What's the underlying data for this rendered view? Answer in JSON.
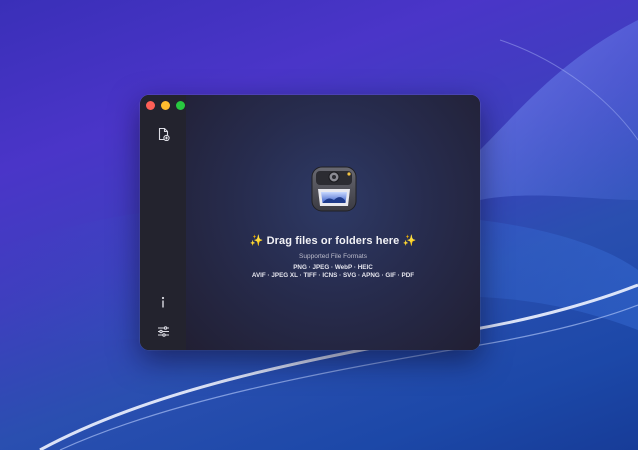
{
  "wallpaper": {
    "accent": "#3a2fb8"
  },
  "window": {
    "traffic_lights": {
      "close": "#fe5f57",
      "minimize": "#febc2e",
      "zoom": "#28c840"
    },
    "sidebar": {
      "items": [
        {
          "icon": "file-add-icon"
        },
        {
          "icon": "info-icon"
        },
        {
          "icon": "sliders-icon"
        }
      ]
    },
    "drop_zone": {
      "icon": "app-icon",
      "title": "✨ Drag files or folders here ✨",
      "formats_label": "Supported File Formats",
      "formats_line1": "PNG · JPEG · WebP · HEIC",
      "formats_line2": "AVIF · JPEG XL · TIFF · ICNS · SVG · APNG · GIF · PDF"
    }
  }
}
